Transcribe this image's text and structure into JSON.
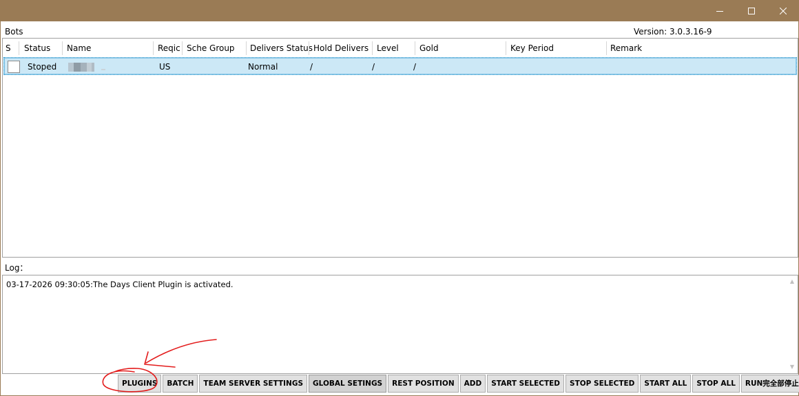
{
  "window": {
    "controls": [
      "minimize-icon",
      "maximize-icon",
      "close-icon"
    ],
    "title_bar_color": "#9a7b55"
  },
  "bots": {
    "label": "Bots",
    "version": "Version: 3.0.3.16-9",
    "columns": [
      "S",
      "Status",
      "Name",
      "Reqic",
      "Sche Group",
      "Delivers Status",
      "Hold Delivers",
      "Level",
      "Gold",
      "Key Period",
      "Remark"
    ],
    "rows": [
      {
        "status": "Stoped",
        "reqic": "US",
        "delivers_status": "Normal",
        "hold_delivers": "/",
        "level": "/",
        "gold": "/"
      }
    ],
    "selection_color": "#cce8f6"
  },
  "log": {
    "label": "Log：",
    "lines": [
      "03-17-2026 09:30:05:The Days Client Plugin is activated."
    ]
  },
  "toolbar": {
    "buttons": [
      "PLUGINS",
      "BATCH",
      "TEAM SERVER SETTINGS",
      "GLOBAL SETINGS",
      "REST POSITION",
      "ADD",
      "START SELECTED",
      "STOP SELECTED",
      "START ALL",
      "STOP ALL",
      "RUN完全部停止"
    ],
    "active_button": "GLOBAL SETINGS"
  }
}
